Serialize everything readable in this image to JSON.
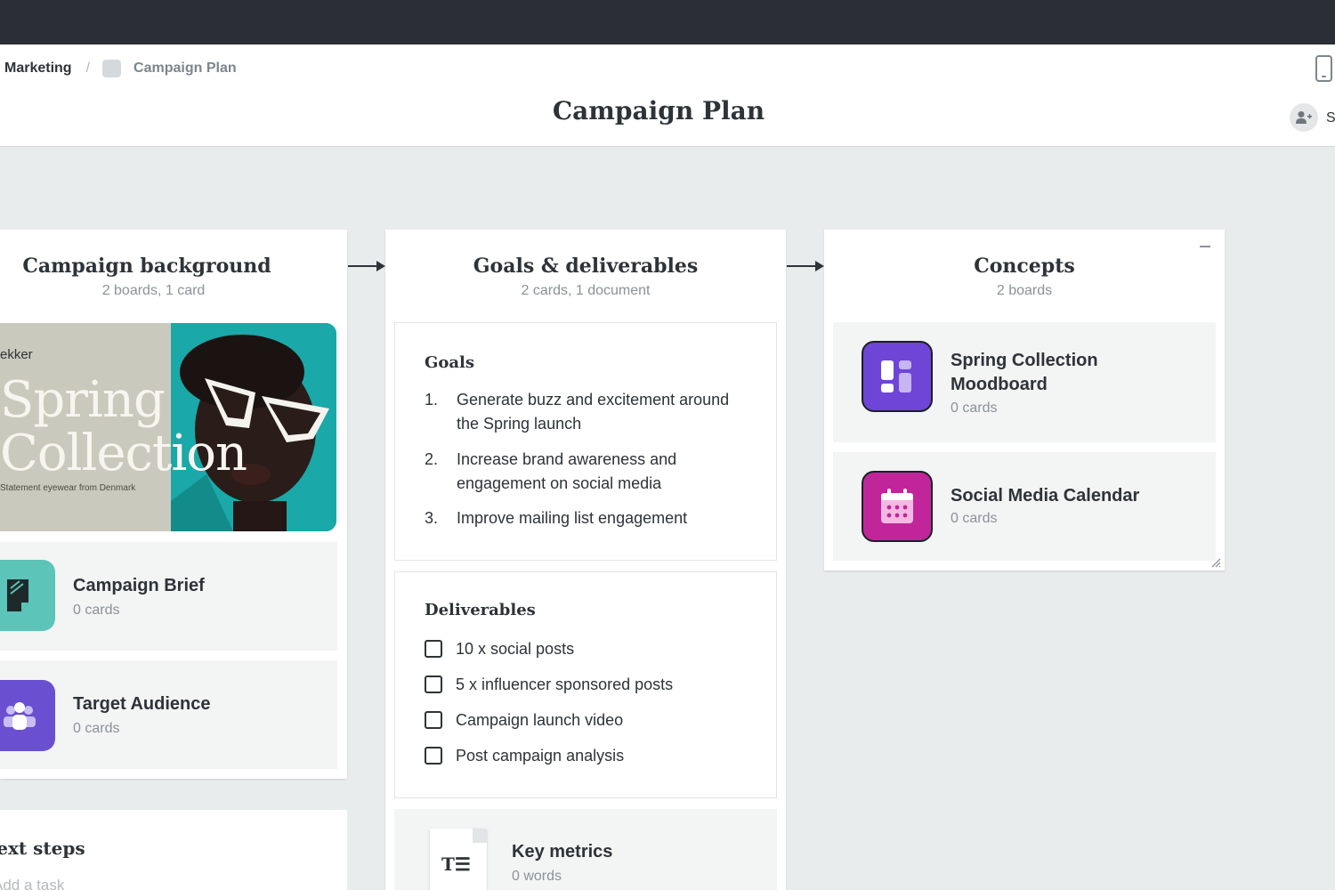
{
  "header": {
    "breadcrumb_root": "Marketing",
    "breadcrumb_sep": "/",
    "breadcrumb_current": "Campaign Plan",
    "title": "Campaign Plan",
    "share_label": "S"
  },
  "columns": {
    "background": {
      "title": "Campaign background",
      "subtitle": "2 boards, 1 card",
      "image_card": {
        "brand": "ekker",
        "headline_1": "Spring",
        "headline_2": "Collection",
        "tagline": "Statement eyewear from Denmark"
      },
      "boards": [
        {
          "title": "Campaign Brief",
          "subtitle": "0 cards",
          "icon": "note-icon",
          "color": "#5cc4b8"
        },
        {
          "title": "Target Audience",
          "subtitle": "0 cards",
          "icon": "people-icon",
          "color": "#6a4fd0"
        }
      ]
    },
    "goals": {
      "title": "Goals & deliverables",
      "subtitle": "2 cards, 1 document",
      "goals_title": "Goals",
      "goals": [
        {
          "num": "1.",
          "text": "Generate buzz and excitement around the Spring launch"
        },
        {
          "num": "2.",
          "text": "Increase brand awareness and engagement on social media"
        },
        {
          "num": "3.",
          "text": "Improve mailing list engagement"
        }
      ],
      "deliverables_title": "Deliverables",
      "deliverables": [
        {
          "label": "10 x social posts",
          "checked": false
        },
        {
          "label": "5 x influencer sponsored posts",
          "checked": false
        },
        {
          "label": "Campaign launch video",
          "checked": false
        },
        {
          "label": "Post campaign analysis",
          "checked": false
        }
      ],
      "document": {
        "title": "Key metrics",
        "subtitle": "0 words",
        "icon": "document-icon"
      }
    },
    "concepts": {
      "title": "Concepts",
      "subtitle": "2 boards",
      "boards": [
        {
          "title_1": "Spring Collection",
          "title_2": "Moodboard",
          "subtitle": "0 cards",
          "icon": "moodboard-icon",
          "color": "#6e45d6"
        },
        {
          "title_1": "Social Media Calendar",
          "subtitle": "0 cards",
          "icon": "calendar-icon",
          "color": "#c0269a"
        }
      ]
    }
  },
  "next_steps": {
    "title": "Next steps",
    "add_task_placeholder": "Add a task"
  },
  "colors": {
    "topbar": "#2c2e36",
    "canvas": "#e9ecec",
    "teal": "#1aa8a8"
  }
}
